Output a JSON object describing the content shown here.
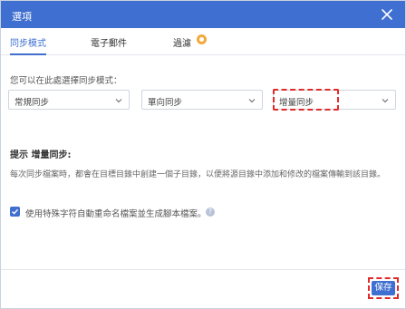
{
  "dialog": {
    "title": "選項",
    "close_icon": "close-icon"
  },
  "tabs": [
    {
      "label": "同步模式",
      "active": true
    },
    {
      "label": "電子郵件",
      "active": false
    },
    {
      "label": "過濾",
      "active": false,
      "badge_icon": "pro-badge-icon"
    }
  ],
  "sync": {
    "label": "您可以在此處選擇同步模式：",
    "selects": [
      {
        "value": "常規同步"
      },
      {
        "value": "單向同步"
      },
      {
        "value": "增量同步"
      }
    ]
  },
  "tip": {
    "title": "提示 增量同步:",
    "body": "每次同步檔案時，都會在目標目錄中創建一個子目錄，以便將源目錄中添加和修改的檔案傳輸到該目錄。"
  },
  "option": {
    "checked": true,
    "label": "使用特殊字符自動重命名檔案並生成腳本檔案。",
    "help_icon": "help-icon"
  },
  "footer": {
    "save_label": "保存"
  },
  "colors": {
    "accent": "#3f6fd0",
    "highlight": "#e02b2b",
    "badge": "#f2a93b"
  }
}
